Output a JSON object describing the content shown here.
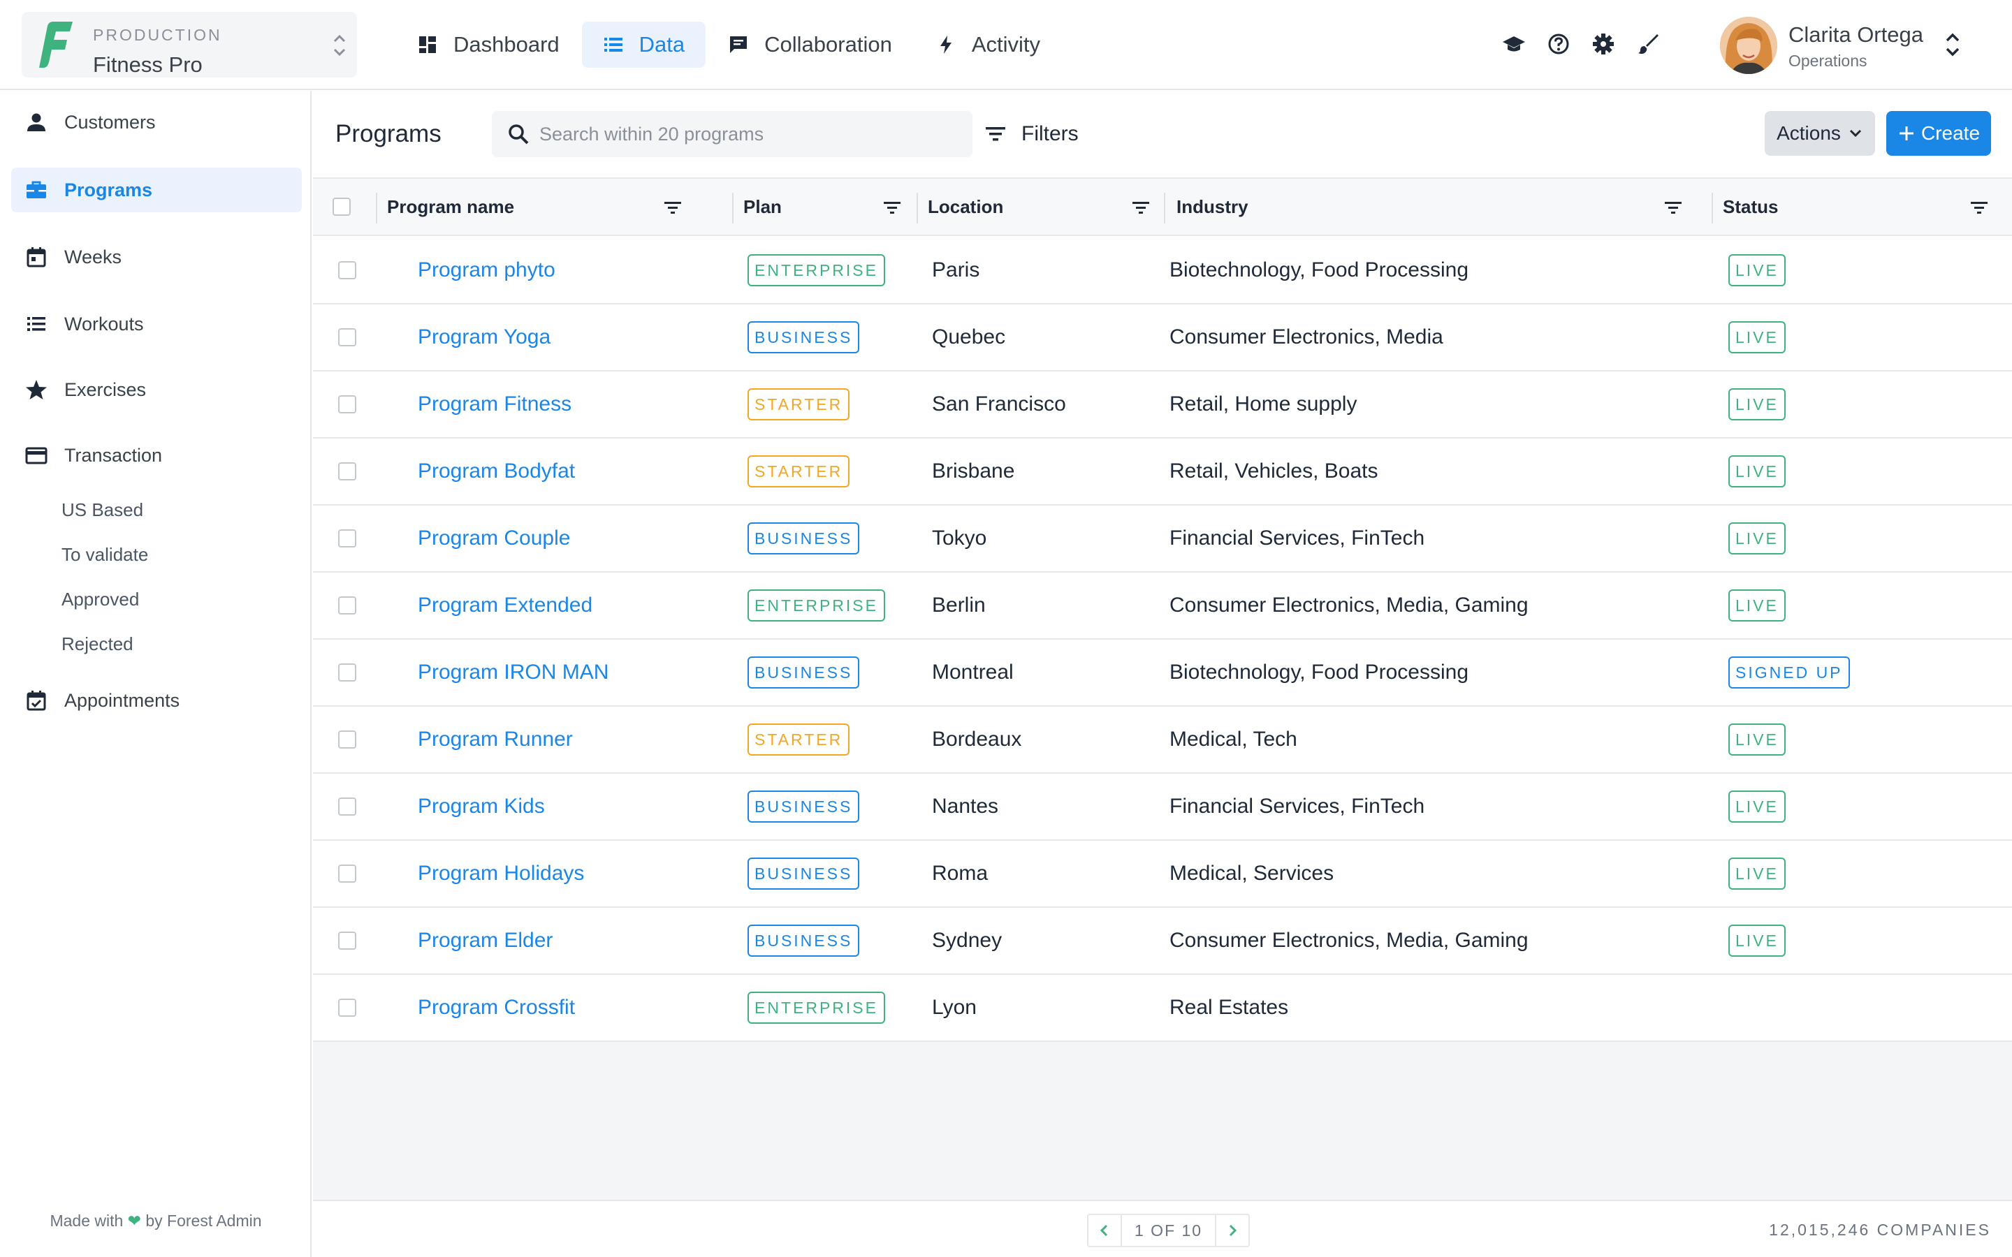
{
  "app": {
    "environment": "PRODUCTION",
    "project": "Fitness Pro"
  },
  "nav": [
    {
      "label": "Dashboard",
      "icon": "dashboard-icon"
    },
    {
      "label": "Data",
      "icon": "list-icon",
      "active": true
    },
    {
      "label": "Collaboration",
      "icon": "chat-icon"
    },
    {
      "label": "Activity",
      "icon": "bolt-icon"
    }
  ],
  "user": {
    "name": "Clarita Ortega",
    "role": "Operations"
  },
  "sidebar": {
    "items": [
      {
        "label": "Customers",
        "icon": "person-icon"
      },
      {
        "label": "Programs",
        "icon": "briefcase-icon",
        "active": true
      },
      {
        "label": "Weeks",
        "icon": "calendar-icon"
      },
      {
        "label": "Workouts",
        "icon": "list-icon"
      },
      {
        "label": "Exercises",
        "icon": "star-icon"
      },
      {
        "label": "Transaction",
        "icon": "credit-card-icon"
      }
    ],
    "sub_items": [
      "US Based",
      "To validate",
      "Approved",
      "Rejected"
    ],
    "last_item": {
      "label": "Appointments",
      "icon": "calendar-check-icon"
    },
    "footer": {
      "before": "Made with",
      "heart": "❤",
      "after": "by Forest Admin"
    }
  },
  "toolbar": {
    "title": "Programs",
    "search_placeholder": "Search within 20 programs",
    "filters_label": "Filters",
    "actions_label": "Actions",
    "create_label": "Create"
  },
  "table": {
    "columns": [
      "Program name",
      "Plan",
      "Location",
      "Industry",
      "Status"
    ],
    "rows": [
      {
        "name": "Program phyto",
        "plan": "ENTERPRISE",
        "location": "Paris",
        "industry": "Biotechnology, Food Processing",
        "status": "LIVE"
      },
      {
        "name": "Program Yoga",
        "plan": "BUSINESS",
        "location": "Quebec",
        "industry": "Consumer Electronics, Media",
        "status": "LIVE"
      },
      {
        "name": "Program Fitness",
        "plan": "STARTER",
        "location": "San Francisco",
        "industry": "Retail, Home supply",
        "status": "LIVE"
      },
      {
        "name": "Program Bodyfat",
        "plan": "STARTER",
        "location": "Brisbane",
        "industry": "Retail, Vehicles, Boats",
        "status": "LIVE"
      },
      {
        "name": "Program Couple",
        "plan": "BUSINESS",
        "location": "Tokyo",
        "industry": "Financial Services, FinTech",
        "status": "LIVE"
      },
      {
        "name": "Program Extended",
        "plan": "ENTERPRISE",
        "location": "Berlin",
        "industry": "Consumer Electronics, Media, Gaming",
        "status": "LIVE"
      },
      {
        "name": "Program IRON MAN",
        "plan": "BUSINESS",
        "location": "Montreal",
        "industry": "Biotechnology, Food Processing",
        "status": "SIGNED UP"
      },
      {
        "name": "Program Runner",
        "plan": "STARTER",
        "location": "Bordeaux",
        "industry": "Medical, Tech",
        "status": "LIVE"
      },
      {
        "name": "Program Kids",
        "plan": "BUSINESS",
        "location": "Nantes",
        "industry": "Financial Services, FinTech",
        "status": "LIVE"
      },
      {
        "name": "Program Holidays",
        "plan": "BUSINESS",
        "location": "Roma",
        "industry": "Medical, Services",
        "status": "LIVE"
      },
      {
        "name": "Program Elder",
        "plan": "BUSINESS",
        "location": "Sydney",
        "industry": "Consumer Electronics, Media, Gaming",
        "status": "LIVE"
      },
      {
        "name": "Program Crossfit",
        "plan": "ENTERPRISE",
        "location": "Lyon",
        "industry": "Real Estates",
        "status": ""
      }
    ]
  },
  "badge_colors": {
    "ENTERPRISE": "#3fb37f",
    "BUSINESS": "#1a87e6",
    "STARTER": "#f5a623",
    "LIVE": "#3fb37f",
    "SIGNED UP": "#1a87e6"
  },
  "pagination": {
    "label": "1 OF 10",
    "total": "12,015,246 COMPANIES"
  },
  "colors": {
    "accent": "#1a87e6",
    "accent_bg": "#eaf3fd"
  }
}
